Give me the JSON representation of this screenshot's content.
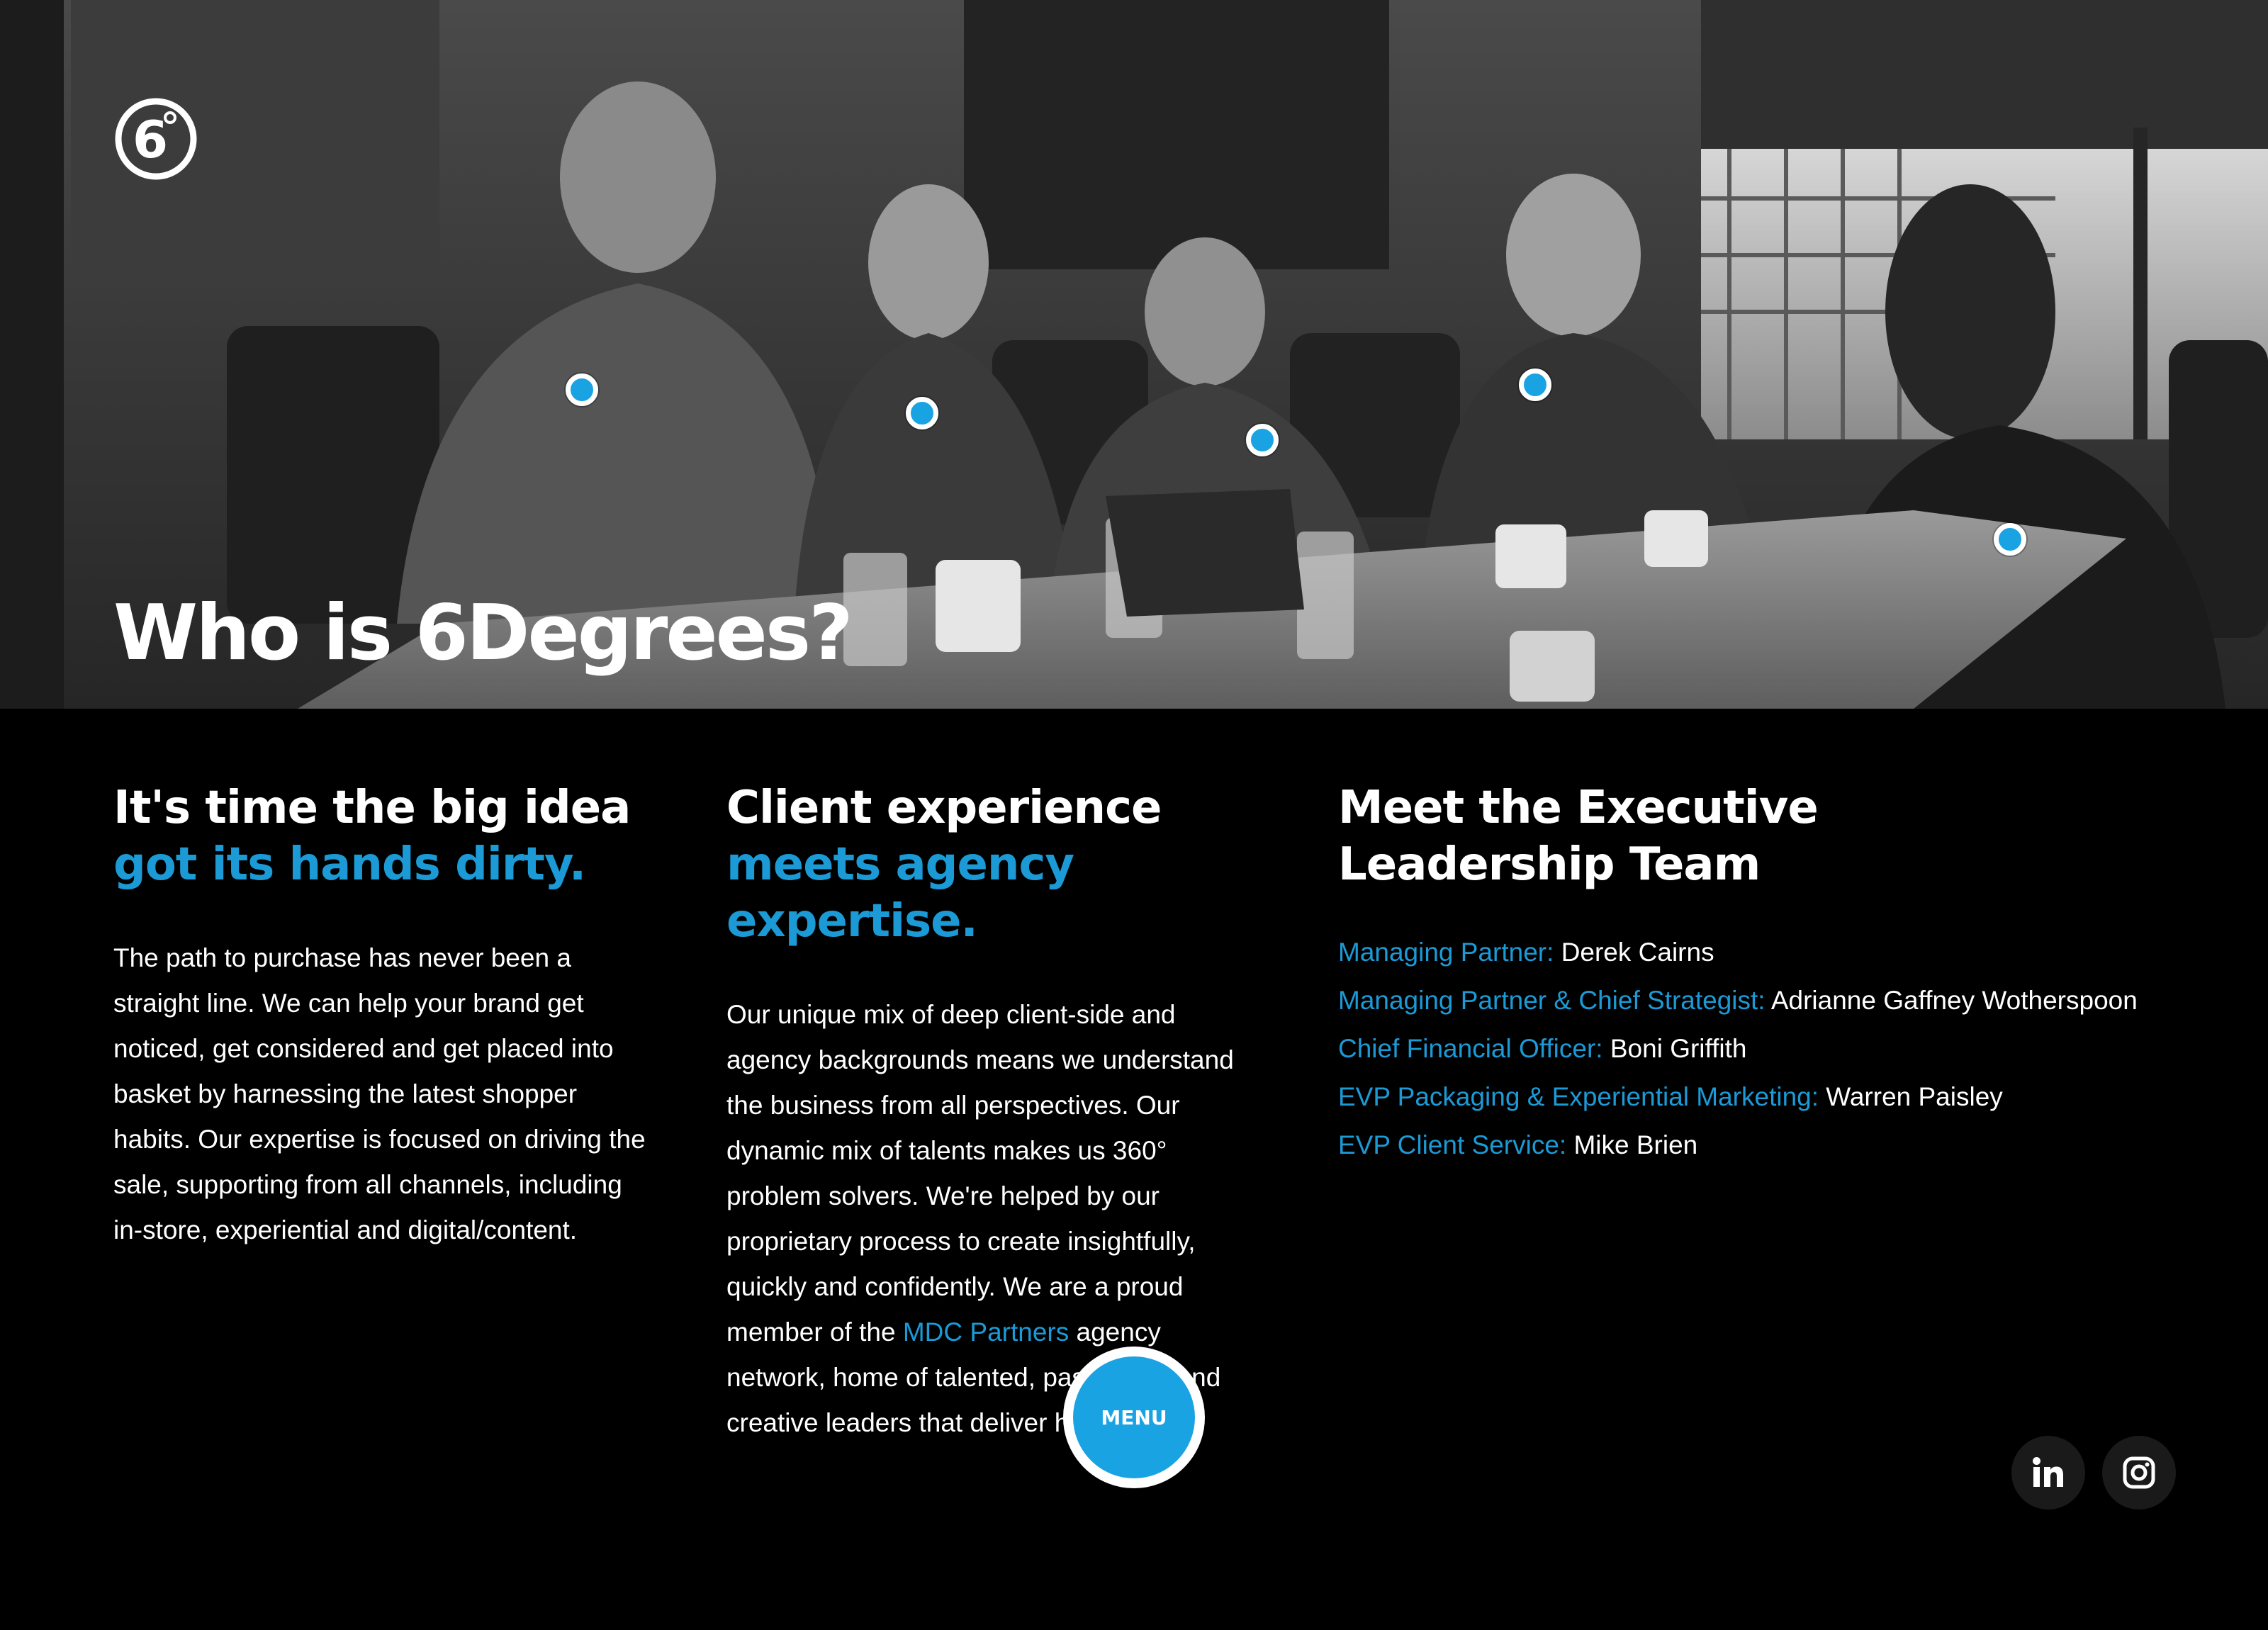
{
  "hero": {
    "title": "Who is 6Degrees?",
    "logo_text": "6°",
    "hotspot_color": "#1aa3e3"
  },
  "columns": [
    {
      "heading_lines": [
        "It's time the big idea"
      ],
      "heading_accent_lines": [
        "got its hands dirty."
      ],
      "body": "The path to purchase has never been a straight line. We can help your brand get noticed, get considered and get placed into basket by harnessing the latest shopper habits. Our expertise is focused on driving the sale, supporting from all channels, including in-store, experiential and digital/content."
    },
    {
      "heading_lines": [
        "Client experience"
      ],
      "heading_accent_lines": [
        "meets agency",
        "expertise."
      ],
      "body_before_link": "Our unique mix of deep client-side and agency backgrounds means we understand the business from all perspectives. Our dynamic mix of talents makes us 360° problem solvers. We're helped by our proprietary process to create insightfully, quickly and confidently. We are a proud member of the ",
      "link_text": "MDC Partners",
      "body_after_link": " agency network, home of talented, passionate and creative leaders that deliver high growth"
    },
    {
      "heading_lines": [
        "Meet the Executive",
        "Leadership Team"
      ],
      "leaders": [
        {
          "role": "Managing Partner:",
          "name": "Derek Cairns"
        },
        {
          "role": "Managing Partner & Chief Strategist:",
          "name": "Adrianne Gaffney Wotherspoon"
        },
        {
          "role": "Chief Financial Officer:",
          "name": "Boni Griffith"
        },
        {
          "role": "EVP Packaging & Experiential Marketing:",
          "name": "Warren Paisley"
        },
        {
          "role": "EVP Client Service:",
          "name": "Mike Brien"
        }
      ]
    }
  ],
  "menu": {
    "label": "MENU"
  },
  "social": {
    "linkedin_icon": "linkedin-icon",
    "instagram_icon": "instagram-icon"
  },
  "colors": {
    "accent": "#1b9ad6",
    "background": "#000000",
    "text": "#ffffff"
  }
}
